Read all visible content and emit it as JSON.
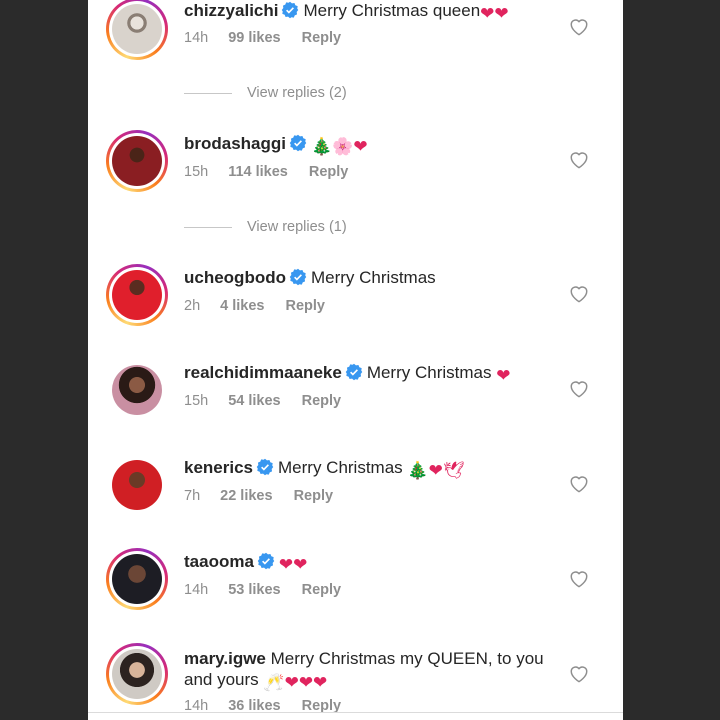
{
  "comments": [
    {
      "username": "chizzyalichi",
      "text": "Merry Christmas queen",
      "emoji": "❤❤",
      "time": "14h",
      "likes": "99 likes",
      "reply": "Reply",
      "view_replies": "View replies (2)"
    },
    {
      "username": "brodashaggi",
      "text": "",
      "emoji": "🎄🌸❤",
      "time": "15h",
      "likes": "114 likes",
      "reply": "Reply",
      "view_replies": "View replies (1)"
    },
    {
      "username": "ucheogbodo",
      "text": "Merry Christmas",
      "emoji": "",
      "time": "2h",
      "likes": "4 likes",
      "reply": "Reply"
    },
    {
      "username": "realchidimmaaneke",
      "text": "Merry Christmas",
      "emoji": "❤",
      "time": "15h",
      "likes": "54 likes",
      "reply": "Reply"
    },
    {
      "username": "kenerics",
      "text": "Merry Christmas",
      "emoji": "🎄❤🕊",
      "time": "7h",
      "likes": "22 likes",
      "reply": "Reply"
    },
    {
      "username": "taaooma",
      "text": "",
      "emoji": "❤❤",
      "time": "14h",
      "likes": "53 likes",
      "reply": "Reply"
    },
    {
      "username": "mary.igwe",
      "text": "Merry Christmas my QUEEN, to you and yours",
      "emoji": "🥂❤❤❤",
      "time": "14h",
      "likes": "36 likes",
      "reply": "Reply"
    }
  ],
  "icons": {
    "verified": "verified-badge-icon",
    "like": "heart-outline-icon"
  },
  "colors": {
    "verified": "#3897f0",
    "heart": "#e0245e",
    "muted": "#8e8e8e",
    "text": "#262626"
  }
}
